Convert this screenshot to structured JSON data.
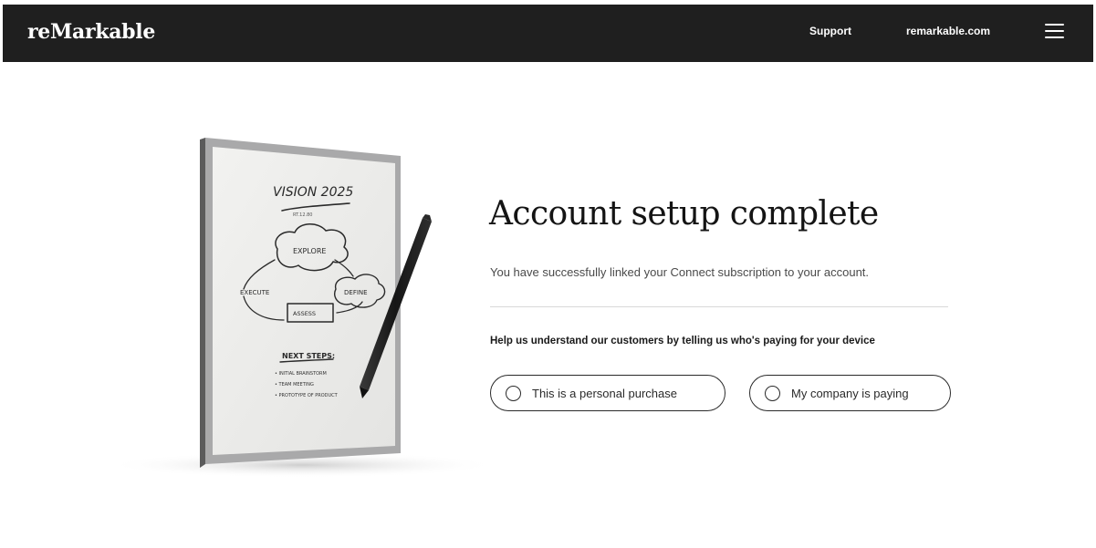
{
  "header": {
    "logo": "reMarkable",
    "nav": {
      "support": "Support",
      "site": "remarkable.com"
    },
    "menu_icon": "hamburger-menu-icon"
  },
  "illustration": {
    "tablet_screen": {
      "title": "VISION 2025",
      "subtitle": "RT.12.80",
      "nodes": [
        "EXPLORE",
        "EXECUTE",
        "DEFINE",
        "ASSESS"
      ],
      "next_steps_heading": "NEXT STEPS:",
      "next_steps": [
        "• INITIAL BRAINSTORM",
        "• TEAM MEETING",
        "• PROTOTYPE OF PRODUCT"
      ]
    }
  },
  "main": {
    "title": "Account setup complete",
    "message": "You have successfully linked your Connect subscription to your account.",
    "question": "Help us understand our customers by telling us who's paying for your device",
    "options": [
      {
        "label": "This is a personal purchase",
        "selected": false
      },
      {
        "label": "My company is paying",
        "selected": false
      }
    ]
  },
  "colors": {
    "header_bg": "#1f1f1f",
    "header_text": "#ffffff",
    "page_bg": "#ffffff",
    "text_primary": "#141414",
    "text_secondary": "#4a4a4a",
    "border": "#2a2a2a",
    "divider": "#d8d8d8"
  }
}
